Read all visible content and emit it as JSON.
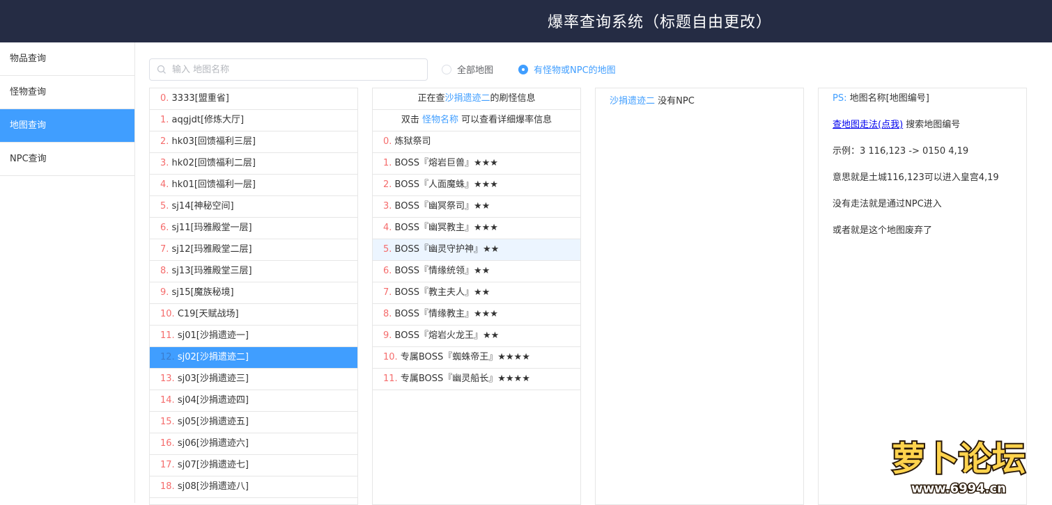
{
  "app": {
    "title": "爆率查询系统（标题自由更改）"
  },
  "sidebar": {
    "items": [
      {
        "label": "物品查询",
        "active": false
      },
      {
        "label": "怪物查询",
        "active": false
      },
      {
        "label": "地图查询",
        "active": true
      },
      {
        "label": "NPC查询",
        "active": false
      }
    ]
  },
  "search": {
    "placeholder": "输入 地图名称",
    "value": ""
  },
  "filter": {
    "options": [
      {
        "label": "全部地图",
        "checked": false
      },
      {
        "label": "有怪物或NPC的地图",
        "checked": true
      }
    ]
  },
  "maps": {
    "items": [
      {
        "idx": "0.",
        "text": " 3333[盟重省]"
      },
      {
        "idx": "1.",
        "text": " aqgjdt[修炼大厅]"
      },
      {
        "idx": "2.",
        "text": " hk03[回馈福利三层]"
      },
      {
        "idx": "3.",
        "text": " hk02[回馈福利二层]"
      },
      {
        "idx": "4.",
        "text": " hk01[回馈福利一层]"
      },
      {
        "idx": "5.",
        "text": " sj14[神秘空间]"
      },
      {
        "idx": "6.",
        "text": " sj11[玛雅殿堂一层]"
      },
      {
        "idx": "7.",
        "text": " sj12[玛雅殿堂二层]"
      },
      {
        "idx": "8.",
        "text": " sj13[玛雅殿堂三层]"
      },
      {
        "idx": "9.",
        "text": " sj15[魔族秘境]"
      },
      {
        "idx": "10.",
        "text": " C19[天赋战场]"
      },
      {
        "idx": "11.",
        "text": " sj01[沙捐遗迹一]"
      },
      {
        "idx": "12.",
        "text": " sj02[沙捐遗迹二]",
        "selected": true
      },
      {
        "idx": "13.",
        "text": " sj03[沙捐遗迹三]"
      },
      {
        "idx": "14.",
        "text": " sj04[沙捐遗迹四]"
      },
      {
        "idx": "15.",
        "text": " sj05[沙捐遗迹五]"
      },
      {
        "idx": "16.",
        "text": " sj06[沙捐遗迹六]"
      },
      {
        "idx": "17.",
        "text": " sj07[沙捐遗迹七]"
      },
      {
        "idx": "18.",
        "text": " sj08[沙捐遗迹八]"
      }
    ]
  },
  "monsters": {
    "header1_pre": "正在查",
    "header1_map": "沙捐遗迹二",
    "header1_post": "的刷怪信息",
    "header2_pre": "双击 ",
    "header2_link": "怪物名称",
    "header2_post": " 可以查看详细爆率信息",
    "items": [
      {
        "idx": "0.",
        "text": " 炼狱祭司"
      },
      {
        "idx": "1.",
        "text": " BOSS『熔岩巨兽』★★★"
      },
      {
        "idx": "2.",
        "text": " BOSS『人面魔蛛』★★★"
      },
      {
        "idx": "3.",
        "text": " BOSS『幽冥祭司』★★"
      },
      {
        "idx": "4.",
        "text": " BOSS『幽冥教主』★★★"
      },
      {
        "idx": "5.",
        "text": " BOSS『幽灵守护神』★★",
        "hover": true
      },
      {
        "idx": "6.",
        "text": " BOSS『情缘统领』★★"
      },
      {
        "idx": "7.",
        "text": " BOSS『教主夫人』★★"
      },
      {
        "idx": "8.",
        "text": " BOSS『情缘教主』★★★"
      },
      {
        "idx": "9.",
        "text": " BOSS『熔岩火龙王』★★"
      },
      {
        "idx": "10.",
        "text": " 专属BOSS『蜘蛛帝王』★★★★"
      },
      {
        "idx": "11.",
        "text": " 专属BOSS『幽灵船长』★★★★"
      }
    ]
  },
  "npc": {
    "map": "沙捐遗迹二",
    "text": " 没有NPC"
  },
  "info": {
    "ps_label": "PS:",
    "ps_text": " 地图名称[地图编号]",
    "link": "查地图走法(点我)",
    "link_post": " 搜索地图编号",
    "example": "示例：3 116,123 -> 0150 4,19",
    "meaning": "意思就是土城116,123可以进入皇宫4,19",
    "no_route": "没有走法就是通过NPC进入",
    "abandoned": "或者就是这个地图废弃了"
  },
  "watermark": {
    "line1": "萝卜论坛",
    "line2": "www.6994.cn"
  },
  "colors": {
    "header_bg": "#252c44",
    "accent": "#409eff",
    "index_red": "#f56c6c"
  }
}
